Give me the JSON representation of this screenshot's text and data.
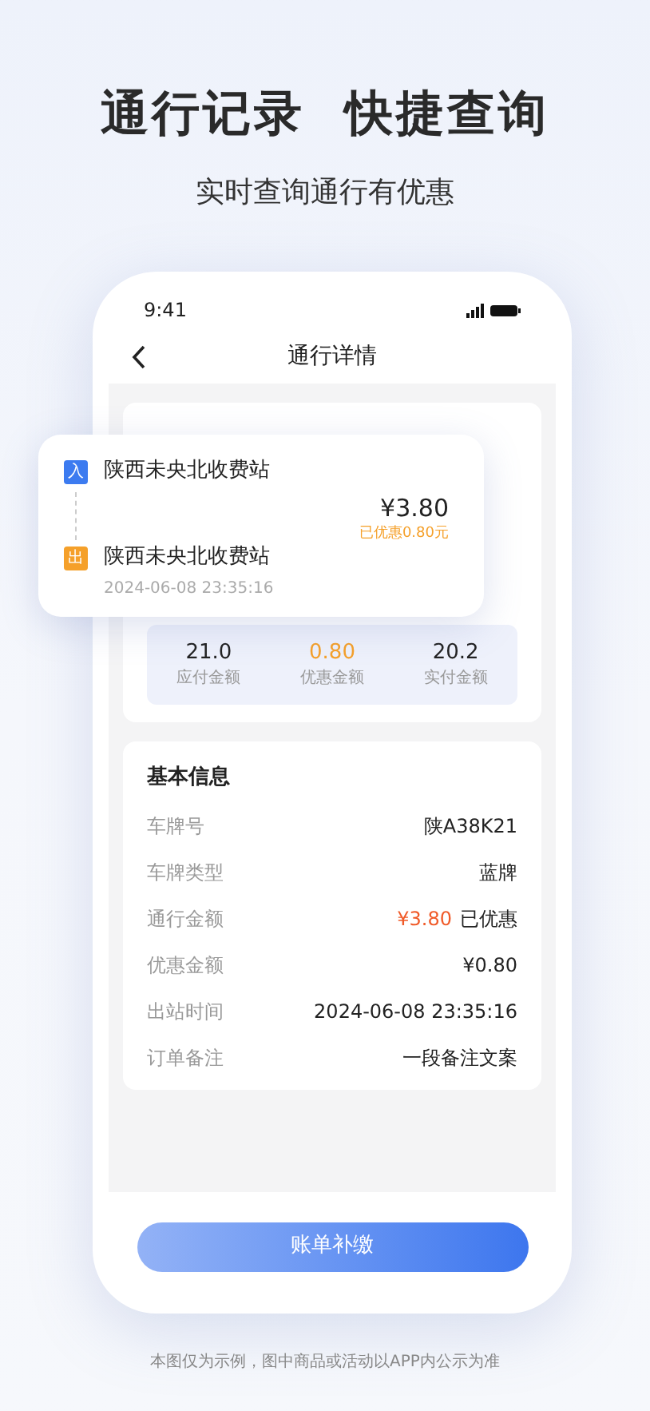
{
  "headline": "通行记录  快捷查询",
  "subheadline": "实时查询通行有优惠",
  "status_bar": {
    "time": "9:41"
  },
  "nav": {
    "title": "通行详情"
  },
  "route": {
    "stops": [
      {
        "tag": "入",
        "color": "#3c7bf0",
        "station": "陕西未央北收费站"
      },
      {
        "tag": "出",
        "color": "#f5a02a",
        "station": "陕西未央北收费站",
        "time": "2024-06-08 23:35:16"
      }
    ],
    "amount": "¥3.80",
    "discount": "已优惠0.80元"
  },
  "stats": [
    {
      "value": "21.0",
      "label": "应付金额",
      "highlight": false
    },
    {
      "value": "0.80",
      "label": "优惠金额",
      "highlight": true
    },
    {
      "value": "20.2",
      "label": "实付金额",
      "highlight": false
    }
  ],
  "basic_info": {
    "title": "基本信息",
    "rows": [
      {
        "label": "车牌号",
        "value": "陕A38K21"
      },
      {
        "label": "车牌类型",
        "value": "蓝牌"
      },
      {
        "label": "通行金额",
        "value": "¥3.80",
        "note": "已优惠"
      },
      {
        "label": "优惠金额",
        "value": "¥0.80"
      },
      {
        "label": "出站时间",
        "value": "2024-06-08 23:35:16"
      },
      {
        "label": "订单备注",
        "value": "一段备注文案"
      }
    ]
  },
  "button": "账单补缴",
  "disclaimer": "本图仅为示例，图中商品或活动以APP内公示为准"
}
